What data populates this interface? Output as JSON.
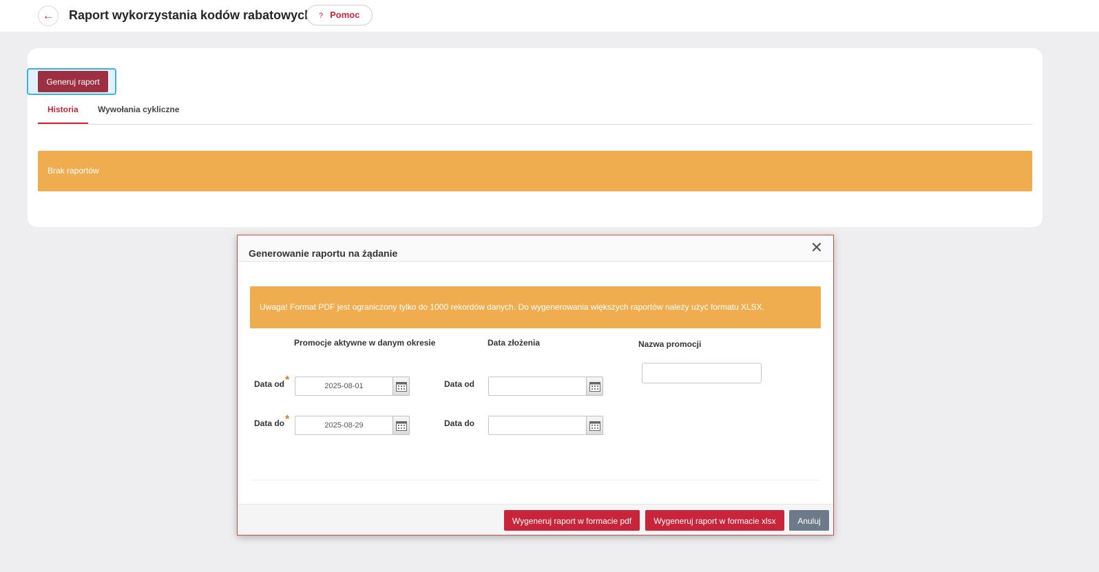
{
  "header": {
    "title": "Raport wykorzystania kodów rabatowych",
    "help_label": "Pomoc",
    "help_icon": "?"
  },
  "toolbar": {
    "generate_label": "Generuj raport"
  },
  "tabs": [
    {
      "label": "Historia",
      "active": true
    },
    {
      "label": "Wywołania cykliczne",
      "active": false
    }
  ],
  "history": {
    "empty_message": "Brak raportów"
  },
  "modal": {
    "title": "Generowanie raportu na żądanie",
    "warning": "Uwaga! Format PDF jest ograniczony tylko do 1000 rekordów danych. Do wygenerowania większych raportów należy użyć formatu XLSX.",
    "sections": {
      "active_promotions": {
        "heading": "Promocje aktywne w danym okresie",
        "from_label": "Data od",
        "from_value": "2025-08-01",
        "to_label": "Data do",
        "to_value": "2025-08-29",
        "required_mark": "*"
      },
      "submission_date": {
        "heading": "Data złożenia",
        "from_label": "Data od",
        "from_value": "",
        "to_label": "Data do",
        "to_value": ""
      },
      "promotion_name": {
        "heading": "Nazwa promocji",
        "value": ""
      }
    },
    "footer": {
      "pdf_label": "Wygeneruj raport w formacie pdf",
      "xlsx_label": "Wygeneruj raport w formacie xlsx",
      "cancel_label": "Anuluj"
    }
  },
  "colors": {
    "brand_red": "#c8253a",
    "generate_button": "#9c2f42",
    "warning_orange": "#efad50",
    "cancel_gray": "#6c7a89"
  }
}
